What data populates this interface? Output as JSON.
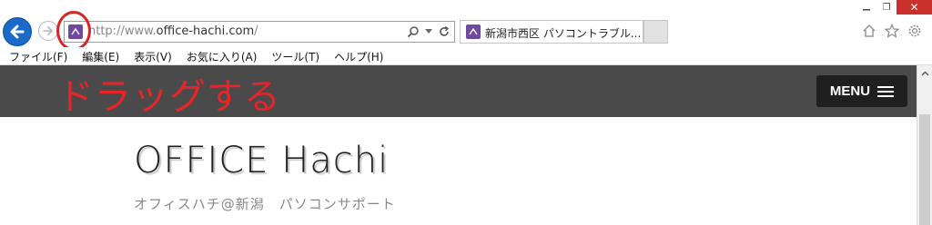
{
  "window": {
    "minimize_icon": "minimize-icon",
    "restore_glyph": "❐",
    "close_glyph": "✕"
  },
  "navigation": {
    "back_icon": "back-arrow-icon",
    "forward_icon": "forward-arrow-icon",
    "address": {
      "url_prefix": "http://www.",
      "url_domain": "office-hachi.com",
      "url_suffix": "/"
    },
    "search_icon": "search-icon",
    "refresh_icon": "refresh-icon"
  },
  "tab": {
    "title": "新潟市西区 パソコントラブル..."
  },
  "toolbar_icons": [
    "home-icon",
    "favorites-star-icon",
    "settings-gear-icon"
  ],
  "menu": [
    {
      "label": "ファイル(F)"
    },
    {
      "label": "編集(E)"
    },
    {
      "label": "表示(V)"
    },
    {
      "label": "お気に入り(A)"
    },
    {
      "label": "ツール(T)"
    },
    {
      "label": "ヘルプ(H)"
    }
  ],
  "annotation": {
    "drag_text": "ドラッグする",
    "color": "#e8242b"
  },
  "site": {
    "menu_button_label": "MENU",
    "title": "OFFICE Hachi",
    "subtitle": "オフィスハチ@新潟　パソコンサポート"
  },
  "colors": {
    "header_bg": "#4a4a4a",
    "back_button": "#1b6ac9",
    "favicon": "#6e4a9e",
    "close_button": "#c9302c"
  }
}
